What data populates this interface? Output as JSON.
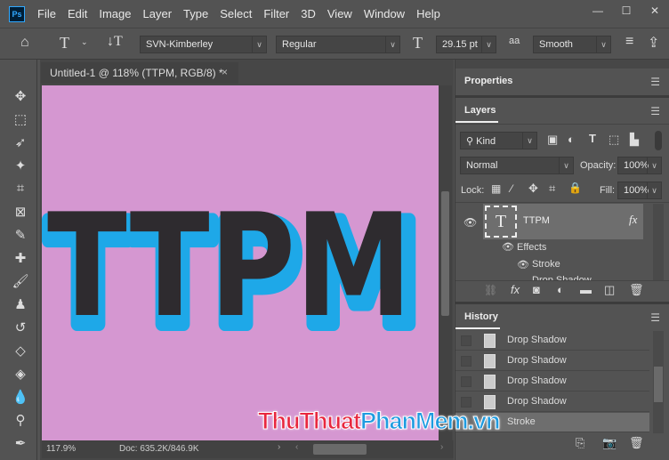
{
  "app": {
    "logo": "Ps"
  },
  "menu": [
    "File",
    "Edit",
    "Image",
    "Layer",
    "Type",
    "Select",
    "Filter",
    "3D",
    "View",
    "Window",
    "Help"
  ],
  "window_controls": {
    "minimize": "—",
    "maximize": "☐",
    "close": "✕"
  },
  "options": {
    "font_family": "SVN-Kimberley",
    "font_style": "Regular",
    "font_size": "29.15 pt",
    "antialias_icon": "aa",
    "antialias": "Smooth"
  },
  "document": {
    "tab_title": "Untitled-1 @ 118% (TTPM, RGB/8) *",
    "text": "TTPM",
    "zoom": "117.9%",
    "doc_size": "Doc: 635.2K/846.9K",
    "canvas_color": "#d597d1",
    "text_color": "#2e2b2f",
    "stroke_color": "#1ea8e8"
  },
  "panels": {
    "properties_tab": "Properties",
    "layers_tab": "Layers",
    "filter_kind": "Kind",
    "blend_mode": "Normal",
    "opacity_label": "Opacity:",
    "opacity": "100%",
    "lock_label": "Lock:",
    "fill_label": "Fill:",
    "fill": "100%",
    "layer": {
      "name": "TTPM",
      "thumb": "T",
      "fx": "fx",
      "effects": "Effects",
      "stroke": "Stroke",
      "drop_shadow": "Drop Shadow"
    },
    "history_tab": "History",
    "history": [
      "Drop Shadow",
      "Drop Shadow",
      "Drop Shadow",
      "Drop Shadow",
      "Stroke"
    ]
  },
  "watermark": {
    "part1": "ThuThuat",
    "part2": "PhanMem",
    "part3": ".vn"
  }
}
